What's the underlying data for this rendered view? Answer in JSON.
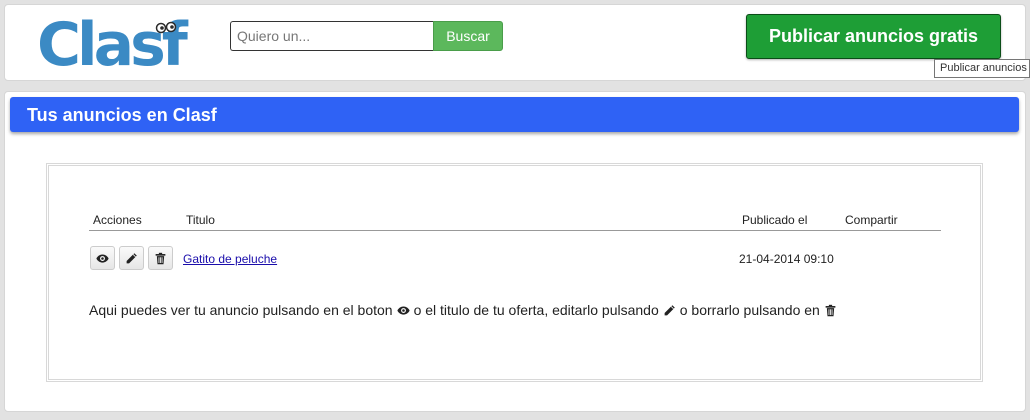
{
  "header": {
    "logo_text": "Clasf",
    "search": {
      "placeholder": "Quiero un...",
      "value": "",
      "button_label": "Buscar"
    },
    "publish_button_label": "Publicar anuncios gratis",
    "publish_tooltip": "Publicar anuncios gratis"
  },
  "panel": {
    "title": "Tus anuncios en Clasf",
    "table": {
      "headers": {
        "actions": "Acciones",
        "title": "Titulo",
        "published": "Publicado el",
        "share": "Compartir"
      },
      "rows": [
        {
          "title": "Gatito de peluche",
          "published": "21-04-2014 09:10",
          "share": ""
        }
      ]
    },
    "help": {
      "part1": "Aqui puedes ver tu anuncio pulsando en el boton",
      "part2": "o el titulo de tu oferta, editarlo pulsando",
      "part3": "o borrarlo pulsando en"
    }
  },
  "colors": {
    "brand_blue": "#2f62f5",
    "publish_green": "#1e9e36",
    "search_green": "#5cb85c",
    "link": "#1a0dab",
    "logo_blue": "#3b8ac4",
    "logo_dark": "#2b2b2b"
  },
  "icons": [
    "eye-icon",
    "pencil-icon",
    "trash-icon"
  ]
}
